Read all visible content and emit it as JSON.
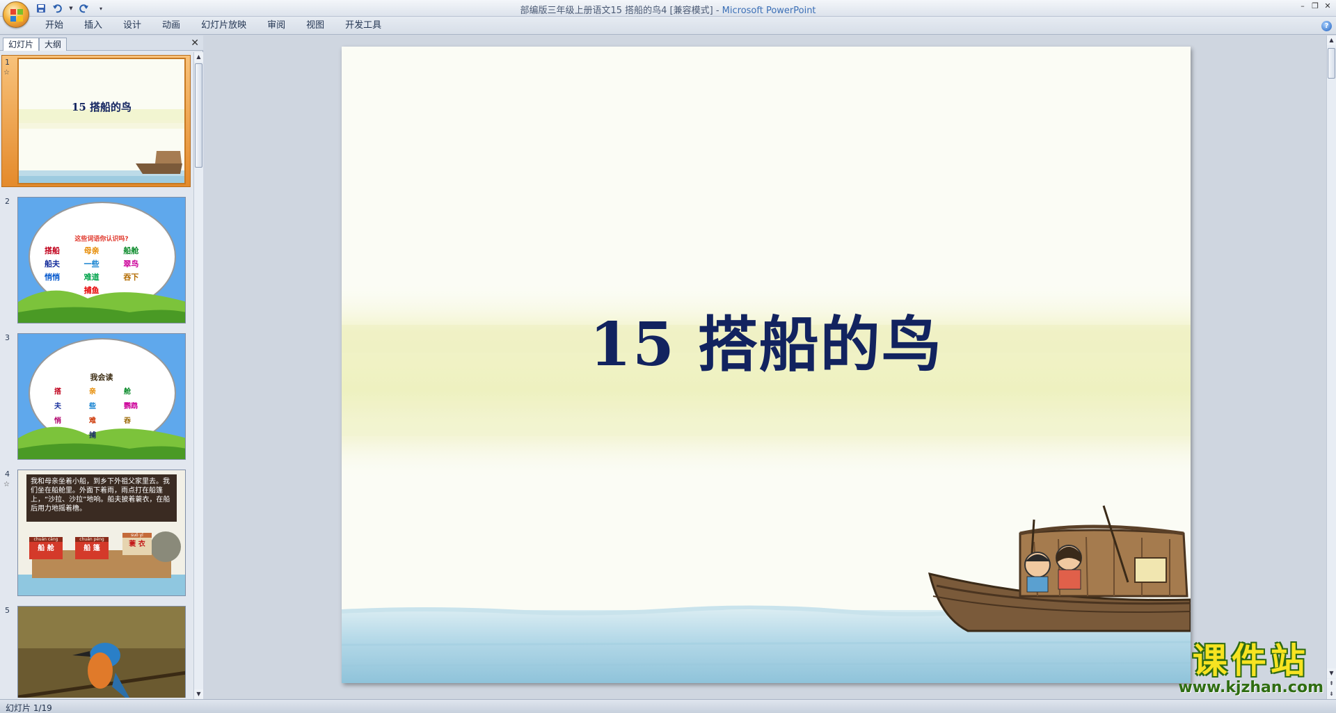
{
  "window": {
    "title": "部编版三年级上册语文15 搭船的鸟4 [兼容模式]",
    "app_name": "Microsoft PowerPoint",
    "controls": [
      "minimize-icon",
      "restore-icon",
      "close-icon"
    ]
  },
  "quick_access": [
    "save-icon",
    "undo-icon",
    "redo-icon",
    "customize-icon"
  ],
  "ribbon": {
    "tabs": [
      "开始",
      "插入",
      "设计",
      "动画",
      "幻灯片放映",
      "审阅",
      "视图",
      "开发工具"
    ]
  },
  "left_panel": {
    "tabs": [
      "幻灯片",
      "大纲"
    ],
    "slides": [
      {
        "num": "1",
        "title": "15  搭船的鸟"
      },
      {
        "num": "2",
        "heading": "这些词语你认识吗?",
        "words": [
          "搭船",
          "母亲",
          "船舱",
          "船夫",
          "一些",
          "翠鸟",
          "悄悄",
          "难道",
          "吞下",
          "捕鱼"
        ],
        "word_colors": [
          "#c0001b",
          "#e68a00",
          "#0a8a2a",
          "#162e9c",
          "#0077cc",
          "#cc0099",
          "#0055cc",
          "#00a34a",
          "#b36b00",
          "#e60000"
        ]
      },
      {
        "num": "3",
        "heading": "我会读",
        "chars": [
          "搭",
          "亲",
          "舱",
          "夫",
          "些",
          "鹦鹉",
          "悄",
          "难",
          "吞",
          "捕"
        ],
        "char_colors": [
          "#c0001b",
          "#e68a00",
          "#0a8a2a",
          "#162e9c",
          "#0077cc",
          "#cc0099",
          "#b0006a",
          "#cc3300",
          "#996600",
          "#1a2a6c"
        ]
      },
      {
        "num": "4",
        "passage": "我和母亲坐着小船，到乡下外祖父家里去。我们坐在船舱里。外面下着雨，雨点打在船篷上，“沙拉、沙拉”地响。船夫披着蓑衣，在船后用力地摇着橹。",
        "labels": [
          {
            "pinyin": "chuán cāng",
            "word": "船 舱"
          },
          {
            "pinyin": "chuán péng",
            "word": "船 篷"
          },
          {
            "pinyin": "suō yī",
            "word": "蓑 衣"
          }
        ]
      },
      {
        "num": "5"
      }
    ]
  },
  "slide": {
    "title": "15  搭船的鸟"
  },
  "watermark": {
    "big": "课件站",
    "small": "www.kjzhan.com"
  },
  "status": {
    "text": "幻灯片 1/19"
  },
  "colors": {
    "title": "#12235f",
    "watermark_yellow": "#f7e321",
    "watermark_green": "#2f6d12"
  }
}
